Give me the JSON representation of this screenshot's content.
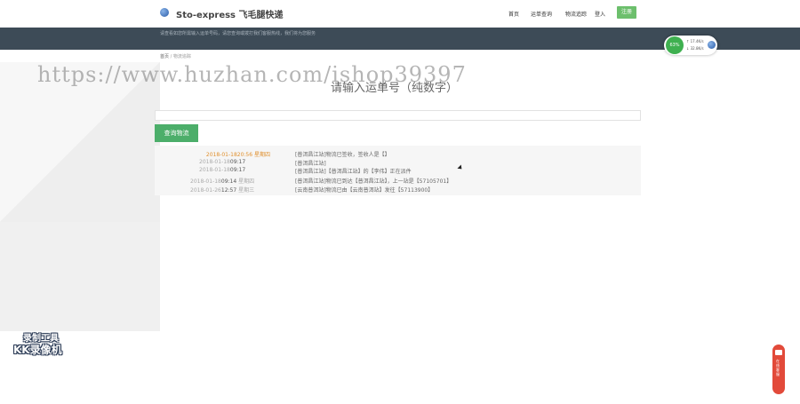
{
  "header": {
    "brand": "Sto-express 飞毛腿快递",
    "nav": [
      {
        "label": "首页"
      },
      {
        "label": "运单查询"
      },
      {
        "label": "物流追踪"
      },
      {
        "label": "登入"
      }
    ],
    "register_label": "注册"
  },
  "banner": {
    "text": "请查看如您所需输入运单号码，请您查询或拨打我们客服热线，我们将为您服务"
  },
  "breadcrumb": {
    "home": "首页",
    "separator": "/",
    "current": "物流追踪"
  },
  "watermark": "https://www.huzhan.com/ishop39397",
  "main": {
    "heading": "请输入运单号（纯数字）",
    "input_value": "",
    "query_button": "查询物流"
  },
  "tracking": [
    {
      "date": "2018-01-18",
      "clock": "20:56",
      "weekday": "星期四",
      "desc": "[普洱昌江站]物流已签收，签收人是【】",
      "latest": true
    },
    {
      "date": "2018-01-18",
      "clock": "09:17",
      "weekday": "",
      "desc": "[普洱昌江站]",
      "latest": false
    },
    {
      "date": "2018-01-18",
      "clock": "09:17",
      "weekday": "",
      "desc": "[普洱昌江站]【普洱昌江站】的【李伟】正在派件",
      "latest": false
    },
    {
      "date": "2018-01-18",
      "clock": "09:14",
      "weekday": "星期四",
      "desc": "[普洱昌江站]物流已到达【普洱昌江站】，上一站是【57105701】",
      "latest": false
    },
    {
      "date": "2018-01-26",
      "clock": "12:57",
      "weekday": "星期三",
      "desc": "[云南普洱站]物流已由【云南普洱站】发往【57113900】",
      "latest": false
    }
  ],
  "network_widget": {
    "percent": "63%",
    "up": "17.4K/s",
    "down": "32.8K/s"
  },
  "recorder": {
    "line1": "录制工具",
    "line2": "KK录像机"
  },
  "side_tab": {
    "label": "在线客服"
  },
  "colors": {
    "banner": "#3d4b57",
    "accent_green": "#4cae6a",
    "latest_orange": "#e0902e",
    "side_tab_red": "#e24a3a"
  }
}
